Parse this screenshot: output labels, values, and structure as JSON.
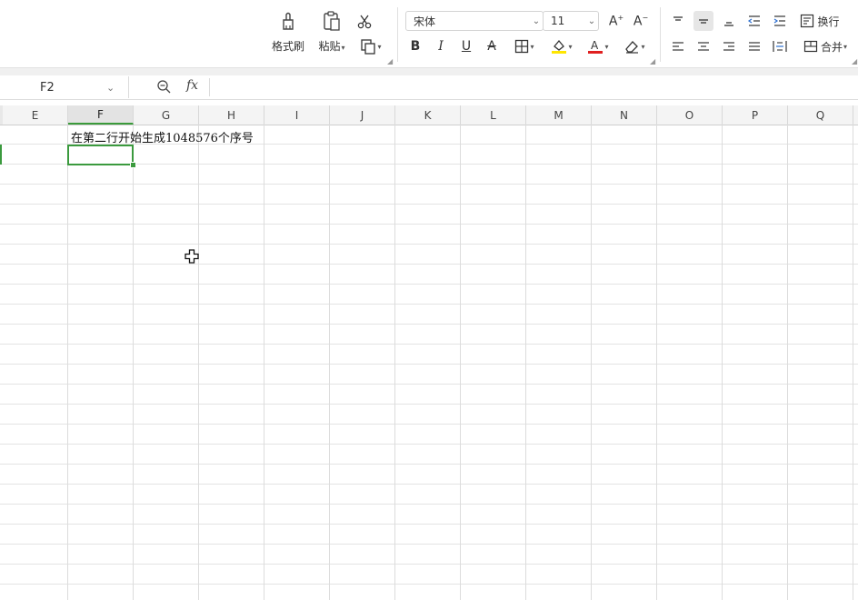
{
  "toolbar": {
    "format_painter_label": "格式刷",
    "paste_label": "粘贴",
    "font_name": "宋体",
    "font_size": "11",
    "wrap_label": "换行",
    "merge_label": "合并"
  },
  "formula_bar": {
    "name_box": "F2",
    "fx_label": "fx"
  },
  "grid": {
    "columns": [
      "E",
      "F",
      "G",
      "H",
      "I",
      "J",
      "K",
      "L",
      "M",
      "N",
      "O",
      "P",
      "Q"
    ],
    "active_column": "F",
    "cells": {
      "F1": "在第二行开始生成1048576个序号"
    }
  },
  "colors": {
    "selection": "#3b9a3e",
    "highlight_fill": "#ffe600",
    "font_color": "#e02020"
  }
}
